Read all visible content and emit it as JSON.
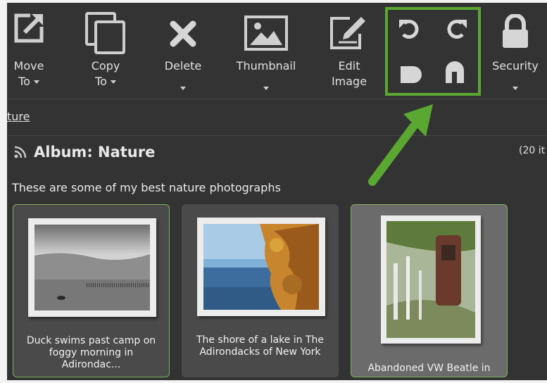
{
  "toolbar": {
    "move": {
      "line1": "Move",
      "line2": "To"
    },
    "copy": {
      "line1": "Copy",
      "line2": "To"
    },
    "delete": {
      "label": "Delete"
    },
    "thumbnail": {
      "label": "Thumbnail"
    },
    "edit": {
      "line1": "Edit",
      "line2": "Image"
    },
    "security": {
      "label": "Security"
    }
  },
  "breadcrumb": "ture",
  "album": {
    "title": "Album: Nature",
    "count": "(20 it",
    "description": "These are some of my best nature photographs"
  },
  "photos": [
    {
      "caption_line1": "Duck swims past camp on",
      "caption_line2": "foggy morning in",
      "caption_line3": "Adirondac..."
    },
    {
      "caption_line1": "The shore of a lake in The",
      "caption_line2": "Adirondacks of New York"
    },
    {
      "caption_line1": "Abandoned VW Beatle in"
    }
  ],
  "colors": {
    "background": "#333333",
    "accent_highlight": "#5aa832",
    "selected_card": "#6b6b6b",
    "card": "#4a4a4a"
  }
}
